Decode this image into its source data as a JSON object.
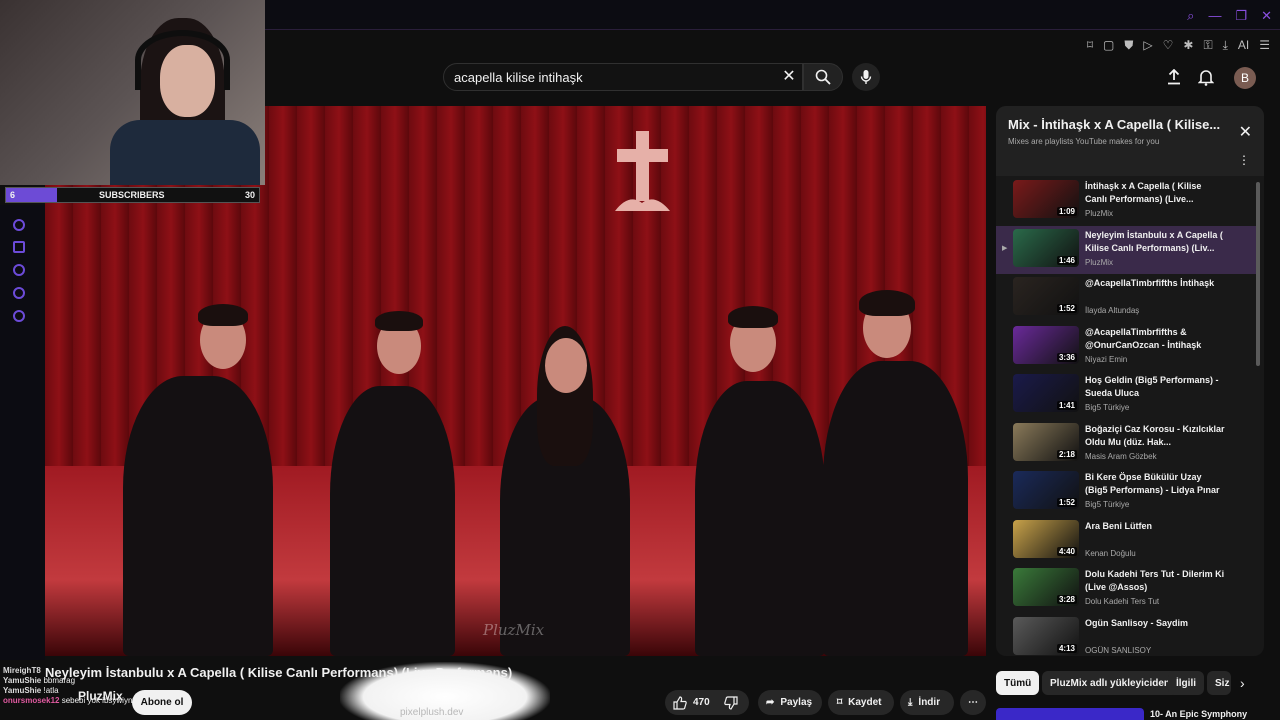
{
  "search": {
    "query": "acapella kilise intihaşk"
  },
  "header": {
    "avatar_letter": "B"
  },
  "extensions": {
    "ai_label": "AI"
  },
  "webcam": {
    "subscribers_label": "SUBSCRIBERS",
    "current": "6",
    "goal": "30",
    "progress": 0.2
  },
  "video": {
    "watermark": "PluzMix"
  },
  "playlist": {
    "title": "Mix - İntihaşk x A Capella ( Kilise...",
    "subtitle": "Mixes are playlists YouTube makes for you",
    "items": [
      {
        "title": "İntihaşk x A Capella ( Kilise Canlı Performans) (Live...",
        "channel": "PluzMix",
        "duration": "1:09",
        "thumb_color": "#7a1a1a"
      },
      {
        "title": "Neyleyim İstanbulu x A Capella ( Kilise Canlı Performans) (Liv...",
        "channel": "PluzMix",
        "duration": "1:46",
        "thumb_color": "#2a6a4a"
      },
      {
        "title": "@AcapellaTimbrfifths İntihaşk",
        "channel": "İlayda Altundaş",
        "duration": "1:52",
        "thumb_color": "#2a2420"
      },
      {
        "title": "@AcapellaTimbrfifths & @OnurCanOzcan - İntihaşk",
        "channel": "Niyazi Emin",
        "duration": "3:36",
        "thumb_color": "#6a2a9a"
      },
      {
        "title": "Hoş Geldin (Big5 Performans) - Sueda Uluca",
        "channel": "Big5 Türkiye",
        "duration": "1:41",
        "thumb_color": "#1a1a4a"
      },
      {
        "title": "Boğaziçi Caz Korosu - Kızılcıklar Oldu Mu (düz. Hak...",
        "channel": "Masis Aram Gözbek",
        "duration": "2:18",
        "thumb_color": "#8a7a5a"
      },
      {
        "title": "Bi Kere Öpse Bükülür Uzay (Big5 Performans) - Lidya Pınar",
        "channel": "Big5 Türkiye",
        "duration": "1:52",
        "thumb_color": "#1a2a5a"
      },
      {
        "title": "Ara Beni Lütfen",
        "channel": "Kenan Doğulu",
        "duration": "4:40",
        "thumb_color": "#c8a24a"
      },
      {
        "title": "Dolu Kadehi Ters Tut - Dilerim Ki (Live @Assos)",
        "channel": "Dolu Kadehi Ters Tut",
        "duration": "3:28",
        "thumb_color": "#3a7a3a"
      },
      {
        "title": "Ogün Sanlisoy - Saydim",
        "channel": "OGÜN SANLISOY",
        "duration": "4:13",
        "thumb_color": "#5a5a5a"
      }
    ]
  },
  "below": {
    "video_title": "Neyleyim İstanbulu x A Capella ( Kilise Canlı Performans) (Live Performans)",
    "channel": "PluzMix",
    "subscribe_label": "Abone ol",
    "likes": "470",
    "share_label": "Paylaş",
    "save_label": "Kaydet",
    "download_label": "İndir",
    "cloud_text": "pixelplush.dev"
  },
  "chips": [
    "Tümü",
    "PluzMix adlı yükleyiciden",
    "İlgili",
    "Siz"
  ],
  "next_video": {
    "title": "10- An Epic Symphony"
  },
  "chat": [
    {
      "name": "MireighT8",
      "msg": ""
    },
    {
      "name": "YamuShie",
      "msg": "bbmarag"
    },
    {
      "name": "YamuShie",
      "msg": "!atla"
    },
    {
      "name": "onursmosek12",
      "msg": "sebebi yok ibsywiynwi"
    }
  ]
}
